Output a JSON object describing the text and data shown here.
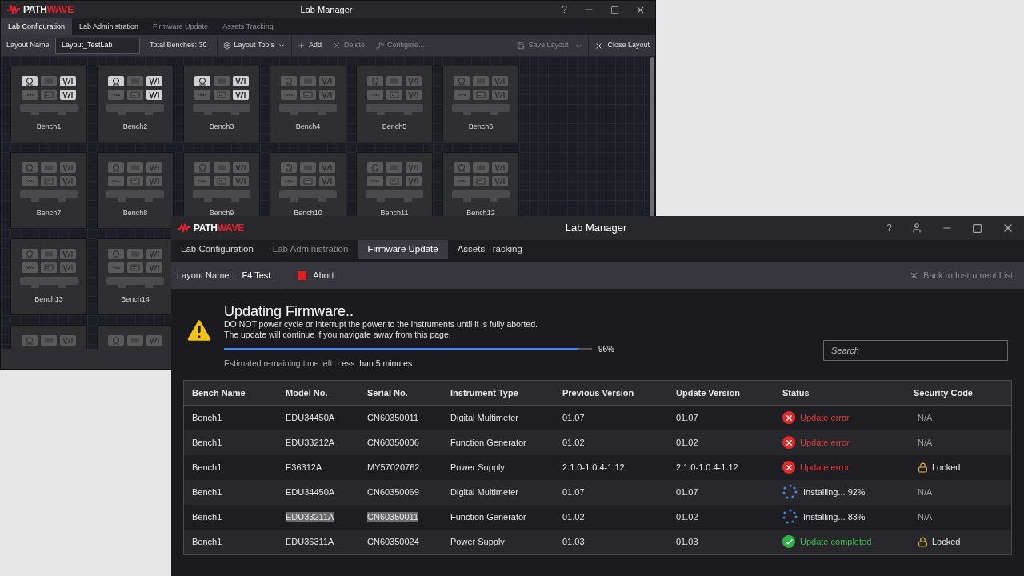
{
  "back_window": {
    "logo": [
      "PATH",
      "WAVE"
    ],
    "title": "Lab Manager",
    "help": "?",
    "tabs": [
      {
        "label": "Lab Configuration",
        "selected": true,
        "disabled": false
      },
      {
        "label": "Lab Administration",
        "selected": false,
        "disabled": false
      },
      {
        "label": "Firmware Update",
        "selected": false,
        "disabled": true
      },
      {
        "label": "Assets Tracking",
        "selected": false,
        "disabled": true
      }
    ],
    "toolbar": {
      "layout_label": "Layout Name:",
      "layout_value": "Layout_TestLab",
      "total": "Total Benches: 30",
      "tools": [
        {
          "label": "Layout Tools",
          "kind": "menu",
          "disabled": false
        },
        {
          "label": "Add",
          "kind": "add",
          "disabled": false
        },
        {
          "label": "Delete",
          "kind": "delete",
          "disabled": true
        },
        {
          "label": "Configure...",
          "kind": "configure",
          "disabled": true
        }
      ],
      "save": {
        "label": "Save Layout",
        "disabled": true
      },
      "close": "Close Layout"
    },
    "bench_rows": [
      [
        {
          "name": "Bench1",
          "lit": [
            true,
            false,
            true,
            false,
            false,
            true
          ]
        },
        {
          "name": "Bench2",
          "lit": [
            true,
            false,
            true,
            false,
            false,
            true
          ]
        },
        {
          "name": "Bench3",
          "lit": [
            true,
            false,
            true,
            false,
            false,
            true
          ]
        },
        {
          "name": "Bench4",
          "lit": [
            false,
            false,
            false,
            false,
            false,
            false
          ]
        },
        {
          "name": "Bench5",
          "lit": [
            false,
            false,
            false,
            false,
            false,
            false
          ]
        },
        {
          "name": "Bench6",
          "lit": [
            false,
            false,
            false,
            false,
            false,
            false
          ]
        }
      ],
      [
        {
          "name": "Bench7",
          "lit": [
            false,
            false,
            false,
            false,
            false,
            false
          ]
        },
        {
          "name": "Bench8",
          "lit": [
            false,
            false,
            false,
            false,
            false,
            false
          ]
        },
        {
          "name": "Bench9",
          "lit": [
            false,
            false,
            false,
            false,
            false,
            false
          ]
        },
        {
          "name": "Bench10",
          "lit": [
            false,
            false,
            false,
            false,
            false,
            false
          ]
        },
        {
          "name": "Bench11",
          "lit": [
            false,
            false,
            false,
            false,
            false,
            false
          ]
        },
        {
          "name": "Bench12",
          "lit": [
            false,
            false,
            false,
            false,
            false,
            false
          ]
        }
      ],
      [
        {
          "name": "Bench13",
          "lit": [
            false,
            false,
            false,
            false,
            false,
            false
          ]
        },
        {
          "name": "Bench14",
          "lit": [
            false,
            false,
            false,
            false,
            false,
            false
          ]
        }
      ],
      [
        {
          "lit": [
            false,
            false,
            false
          ]
        },
        {
          "lit": [
            false,
            false,
            false
          ]
        }
      ]
    ]
  },
  "front_window": {
    "logo": [
      "PATH",
      "WAVE"
    ],
    "title": "Lab Manager",
    "help": "?",
    "tabs": [
      {
        "label": "Lab Configuration",
        "selected": false,
        "disabled": false
      },
      {
        "label": "Lab Administration",
        "selected": false,
        "disabled": true
      },
      {
        "label": "Firmware Update",
        "selected": true,
        "disabled": false
      },
      {
        "label": "Assets Tracking",
        "selected": false,
        "disabled": false
      }
    ],
    "toolbar": {
      "layout_label": "Layout Name:",
      "layout_value": "F4 Test",
      "abort": "Abort",
      "back": {
        "label": "Back to Instrument List",
        "disabled": true
      }
    },
    "update": {
      "heading": "Updating Firmware..",
      "warning": "DO NOT power cycle or interrupt the power to the instruments until it is fully aborted.",
      "note": "The update will continue if you navigate away from this page.",
      "level": 0.96,
      "percent": "96%",
      "eta_label": "Estimated remaining time left:",
      "eta_value": "Less than 5 minutes"
    },
    "search": {
      "placeholder": "Search"
    },
    "table": {
      "columns": [
        "Bench Name",
        "Model No.",
        "Serial No.",
        "Instrument Type",
        "Previous Version",
        "Update Version",
        "Status",
        "Security Code"
      ],
      "rows": [
        {
          "bench": "Bench1",
          "model": "EDU34450A",
          "serial": "CN60350011",
          "type": "Digital Multimeter",
          "previous": "01.07",
          "update": "01.07",
          "status": {
            "kind": "error",
            "text": "Update error"
          },
          "security": {
            "kind": "na",
            "text": "N/A"
          },
          "highlighted": false
        },
        {
          "bench": "Bench1",
          "model": "EDU33212A",
          "serial": "CN60350006",
          "type": "Function Generator",
          "previous": "01.02",
          "update": "01.02",
          "status": {
            "kind": "error",
            "text": "Update error"
          },
          "security": {
            "kind": "na",
            "text": "N/A"
          },
          "highlighted": false
        },
        {
          "bench": "Bench1",
          "model": "E36312A",
          "serial": "MY57020762",
          "type": "Power Supply",
          "previous": "2.1.0-1.0.4-1.12",
          "update": "2.1.0-1.0.4-1.12",
          "status": {
            "kind": "error",
            "text": "Update error"
          },
          "security": {
            "kind": "locked",
            "text": "Locked"
          },
          "highlighted": false
        },
        {
          "bench": "Bench1",
          "model": "EDU34450A",
          "serial": "CN60350069",
          "type": "Digital Multimeter",
          "previous": "01.07",
          "update": "01.07",
          "status": {
            "kind": "installing",
            "text": "Installing... 92%"
          },
          "security": {
            "kind": "na",
            "text": "N/A"
          },
          "highlighted": false
        },
        {
          "bench": "Bench1",
          "model": "EDU33211A",
          "serial": "CN60350011",
          "type": "Function Generator",
          "previous": "01.02",
          "update": "01.02",
          "status": {
            "kind": "installing",
            "text": "Installing... 83%"
          },
          "security": {
            "kind": "na",
            "text": "N/A"
          },
          "highlighted": true
        },
        {
          "bench": "Bench1",
          "model": "EDU36311A",
          "serial": "CN60350024",
          "type": "Power Supply",
          "previous": "01.03",
          "update": "01.03",
          "status": {
            "kind": "completed",
            "text": "Update completed"
          },
          "security": {
            "kind": "locked",
            "text": "Locked"
          },
          "highlighted": false
        }
      ]
    }
  }
}
